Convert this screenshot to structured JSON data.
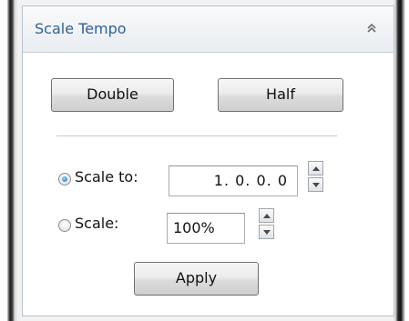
{
  "panel": {
    "title": "Scale Tempo",
    "collapse_icon": "double-chevron-up-icon"
  },
  "buttons": {
    "double_label": "Double",
    "half_label": "Half",
    "apply_label": "Apply"
  },
  "options": {
    "scale_to": {
      "label": "Scale to:",
      "selected": true,
      "value": "1. 0. 0.  0"
    },
    "scale": {
      "label": "Scale:",
      "selected": false,
      "value": "100%"
    }
  },
  "colors": {
    "title_text": "#2f5f9c",
    "radio_selected": "#1b6fc2"
  }
}
